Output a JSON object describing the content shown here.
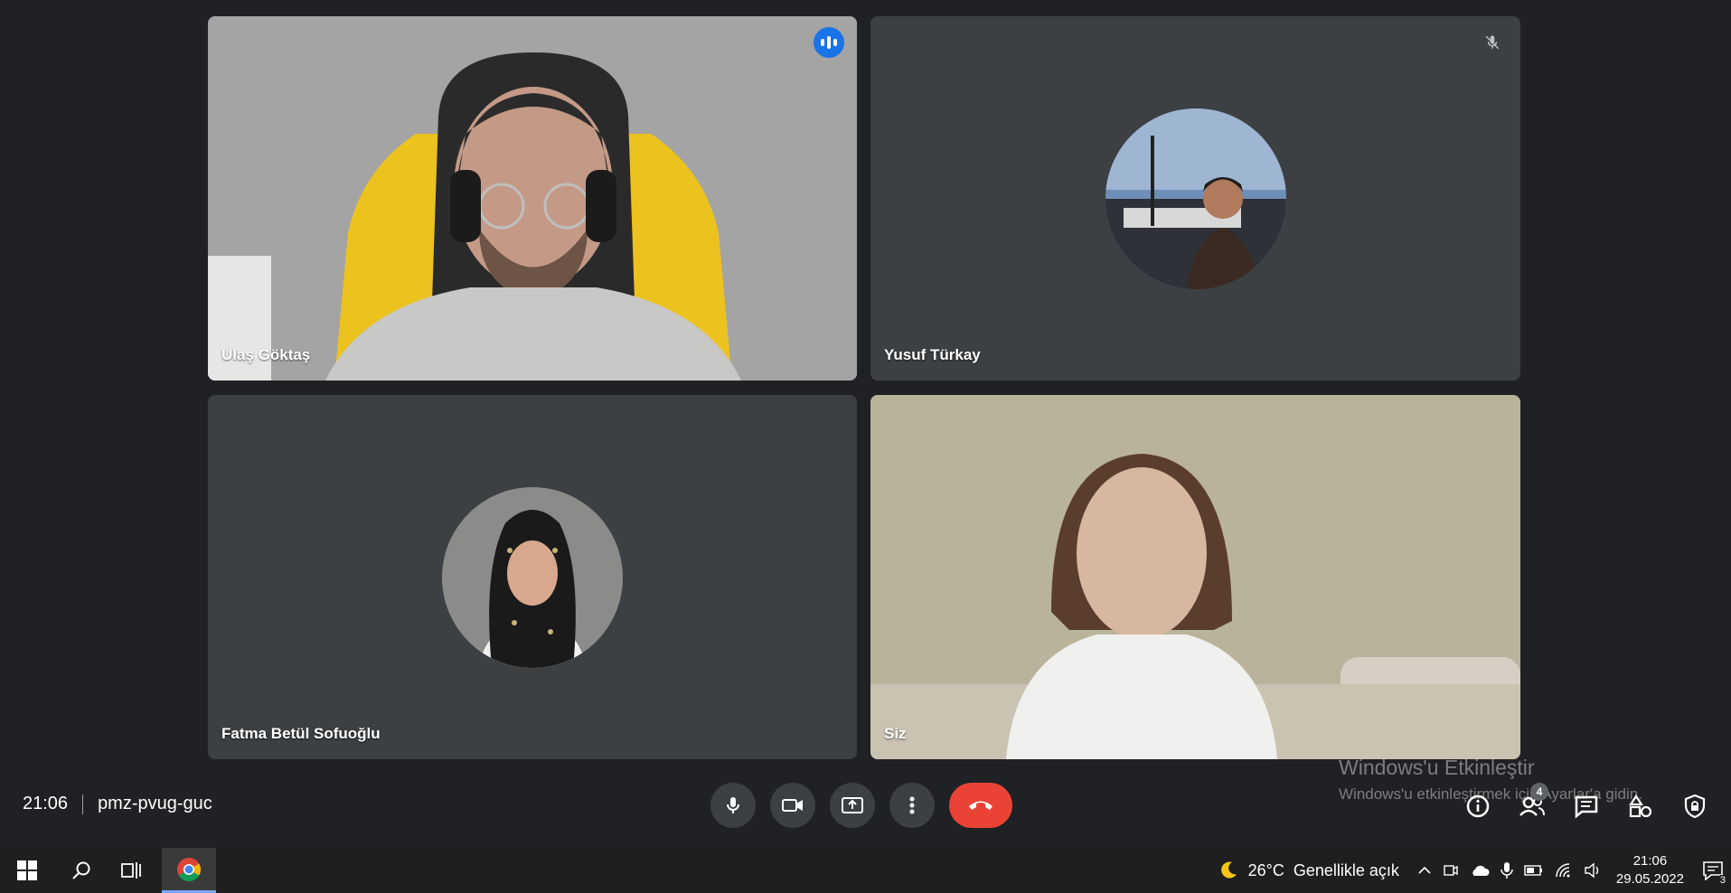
{
  "participants": [
    {
      "name": "Ulaş Göktaş",
      "speaking": true,
      "muted": false,
      "camera": "on"
    },
    {
      "name": "Yusuf Türkay",
      "speaking": false,
      "muted": true,
      "camera": "off"
    },
    {
      "name": "Fatma Betül Sofuoğlu",
      "speaking": false,
      "muted": false,
      "camera": "off"
    },
    {
      "name": "Siz",
      "speaking": false,
      "muted": false,
      "camera": "on"
    }
  ],
  "meeting": {
    "time": "21:06",
    "code": "pmz-pvug-guc"
  },
  "controls": [
    "mic-icon",
    "camera-icon",
    "present-screen-icon",
    "more-options-icon",
    "end-call-icon"
  ],
  "right_tools": {
    "people_count": "4",
    "icons": [
      "info-icon",
      "people-icon",
      "chat-icon",
      "activities-icon",
      "host-controls-icon"
    ]
  },
  "watermark": {
    "title": "Windows'u Etkinleştir",
    "subtitle": "Windows'u etkinleştirmek için Ayarlar'a gidin."
  },
  "taskbar": {
    "weather": {
      "temp": "26°C",
      "desc": "Genellikle açık"
    },
    "clock_time": "21:06",
    "clock_date": "29.05.2022",
    "notifications": "3"
  },
  "colors": {
    "background": "#202124",
    "tile": "#3c4043",
    "speaking_outline": "#8ab4f8",
    "end_call": "#ea4335",
    "badge_blue": "#1a73e8"
  }
}
